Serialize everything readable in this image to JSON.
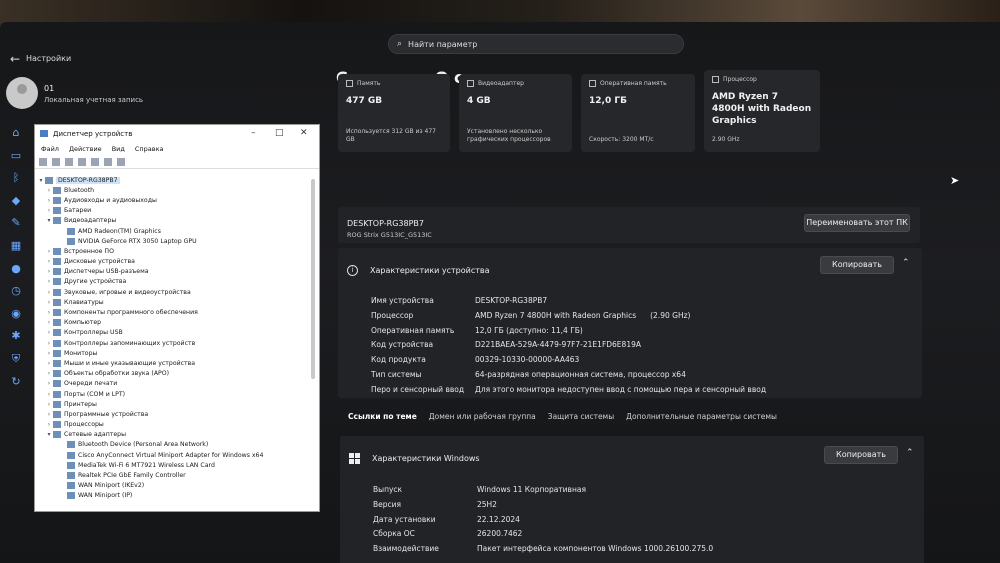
{
  "window": {
    "app_title": "Настройки"
  },
  "search": {
    "placeholder": "Найти параметр"
  },
  "user": {
    "name": "01",
    "account": "Локальная учетная запись"
  },
  "breadcrumb": {
    "part1": "Система",
    "sep": "›",
    "part2": "О системе"
  },
  "cards": [
    {
      "title": "Память",
      "value": "477 GB",
      "sub": "Используется 312 GB из 477 GB"
    },
    {
      "title": "Видеоадаптер",
      "value": "4 GB",
      "sub": "Установлено несколько графических процессоров"
    },
    {
      "title": "Оперативная память",
      "value": "12,0 ГБ",
      "sub": "Скорость: 3200 МТ/с"
    },
    {
      "title": "Процессор",
      "value": "AMD Ryzen 7 4800H with Radeon Graphics",
      "sub": "2.90 GHz"
    }
  ],
  "pc": {
    "name": "DESKTOP-RG38PB7",
    "model": "ROG Strix G513IC_G513IC",
    "rename_label": "Переименовать этот ПК"
  },
  "device_specs": {
    "title": "Характеристики устройства",
    "copy_label": "Копировать",
    "rows": [
      {
        "k": "Имя устройства",
        "v": "DESKTOP-RG38PB7",
        "v2": ""
      },
      {
        "k": "Процессор",
        "v": "AMD Ryzen 7 4800H with Radeon Graphics",
        "v2": "(2.90 GHz)"
      },
      {
        "k": "Оперативная память",
        "v": "12,0 ГБ (доступно: 11,4 ГБ)",
        "v2": ""
      },
      {
        "k": "Код устройства",
        "v": "D221BAEA-529A-4479-97F7-21E1FD6E819A",
        "v2": ""
      },
      {
        "k": "Код продукта",
        "v": "00329-10330-00000-AA463",
        "v2": ""
      },
      {
        "k": "Тип системы",
        "v": "64-разрядная операционная система, процессор x64",
        "v2": ""
      },
      {
        "k": "Перо и сенсорный ввод",
        "v": "Для этого монитора недоступен ввод с помощью пера и сенсорный ввод",
        "v2": ""
      }
    ]
  },
  "related_links": [
    "Ссылки по теме",
    "Домен или рабочая группа",
    "Защита системы",
    "Дополнительные параметры системы"
  ],
  "windows_specs": {
    "title": "Характеристики Windows",
    "copy_label": "Копировать",
    "rows": [
      {
        "k": "Выпуск",
        "v": "Windows 11 Корпоративная"
      },
      {
        "k": "Версия",
        "v": "25H2"
      },
      {
        "k": "Дата установки",
        "v": "22.12.2024"
      },
      {
        "k": "Сборка ОС",
        "v": "26200.7462"
      },
      {
        "k": "Взаимодействие",
        "v": "Пакет интерфейса компонентов Windows 1000.26100.275.0"
      }
    ]
  },
  "device_manager": {
    "title": "Диспетчер устройств",
    "menu": [
      "Файл",
      "Действие",
      "Вид",
      "Справка"
    ],
    "tree": [
      {
        "label": "DESKTOP-RG38PB7",
        "level": 0,
        "exp": "▾"
      },
      {
        "label": "Bluetooth",
        "level": 1,
        "exp": "›"
      },
      {
        "label": "Аудиовходы и аудиовыходы",
        "level": 1,
        "exp": "›"
      },
      {
        "label": "Батареи",
        "level": 1,
        "exp": "›"
      },
      {
        "label": "Видеоадаптеры",
        "level": 1,
        "exp": "▾"
      },
      {
        "label": "AMD Radeon(TM) Graphics",
        "level": 2,
        "exp": ""
      },
      {
        "label": "NVIDIA GeForce RTX 3050 Laptop GPU",
        "level": 2,
        "exp": ""
      },
      {
        "label": "Встроенное ПО",
        "level": 1,
        "exp": "›"
      },
      {
        "label": "Дисковые устройства",
        "level": 1,
        "exp": "›"
      },
      {
        "label": "Диспетчеры USB-разъема",
        "level": 1,
        "exp": "›"
      },
      {
        "label": "Другие устройства",
        "level": 1,
        "exp": "›"
      },
      {
        "label": "Звуковые, игровые и видеоустройства",
        "level": 1,
        "exp": "›"
      },
      {
        "label": "Клавиатуры",
        "level": 1,
        "exp": "›"
      },
      {
        "label": "Компоненты программного обеспечения",
        "level": 1,
        "exp": "›"
      },
      {
        "label": "Компьютер",
        "level": 1,
        "exp": "›"
      },
      {
        "label": "Контроллеры USB",
        "level": 1,
        "exp": "›"
      },
      {
        "label": "Контроллеры запоминающих устройств",
        "level": 1,
        "exp": "›"
      },
      {
        "label": "Мониторы",
        "level": 1,
        "exp": "›"
      },
      {
        "label": "Мыши и иные указывающие устройства",
        "level": 1,
        "exp": "›"
      },
      {
        "label": "Объекты обработки звука (APO)",
        "level": 1,
        "exp": "›"
      },
      {
        "label": "Очереди печати",
        "level": 1,
        "exp": "›"
      },
      {
        "label": "Порты (COM и LPT)",
        "level": 1,
        "exp": "›"
      },
      {
        "label": "Принтеры",
        "level": 1,
        "exp": "›"
      },
      {
        "label": "Программные устройства",
        "level": 1,
        "exp": "›"
      },
      {
        "label": "Процессоры",
        "level": 1,
        "exp": "›"
      },
      {
        "label": "Сетевые адаптеры",
        "level": 1,
        "exp": "▾"
      },
      {
        "label": "Bluetooth Device (Personal Area Network)",
        "level": 2,
        "exp": ""
      },
      {
        "label": "Cisco AnyConnect Virtual Miniport Adapter for Windows x64",
        "level": 2,
        "exp": ""
      },
      {
        "label": "MediaTek Wi-Fi 6 MT7921 Wireless LAN Card",
        "level": 2,
        "exp": ""
      },
      {
        "label": "Realtek PCIe GbE Family Controller",
        "level": 2,
        "exp": ""
      },
      {
        "label": "WAN Miniport (IKEv2)",
        "level": 2,
        "exp": ""
      },
      {
        "label": "WAN Miniport (IP)",
        "level": 2,
        "exp": ""
      }
    ]
  },
  "colors": {
    "accent": "#6aa7ff",
    "background": "#1c1d20",
    "card": "#26272a"
  }
}
